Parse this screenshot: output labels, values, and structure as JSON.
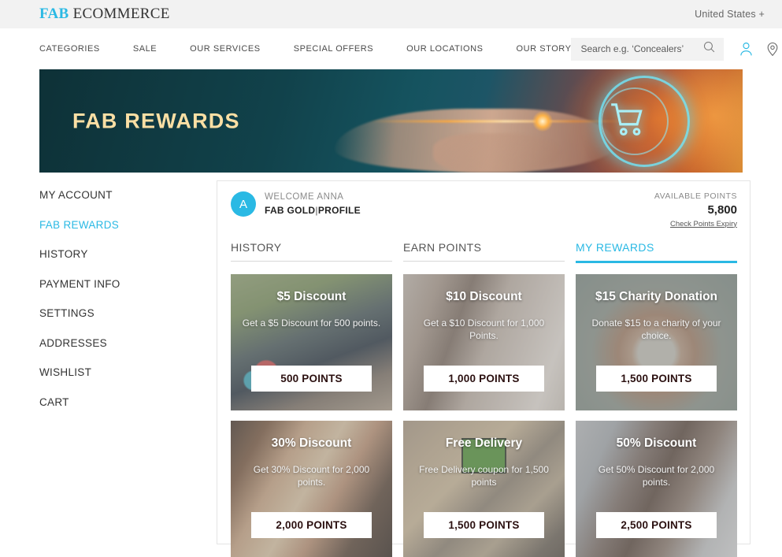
{
  "topbar": {
    "brand_primary": "FAB",
    "brand_secondary": "ECOMMERCE",
    "country": "United States +"
  },
  "nav": {
    "links": [
      {
        "label": "CATEGORIES"
      },
      {
        "label": "SALE"
      },
      {
        "label": "OUR SERVICES"
      },
      {
        "label": "SPECIAL OFFERS"
      },
      {
        "label": "OUR LOCATIONS"
      },
      {
        "label": "OUR STORY"
      }
    ],
    "search": {
      "placeholder": "Search e.g. ‘Concealers’",
      "value": ""
    },
    "icons": [
      "user-icon",
      "location-pin-icon",
      "bag-icon"
    ]
  },
  "hero": {
    "title": "FAB REWARDS"
  },
  "sidebar": {
    "items": [
      {
        "label": "MY ACCOUNT",
        "active": false
      },
      {
        "label": "FAB REWARDS",
        "active": true
      },
      {
        "label": "HISTORY",
        "active": false
      },
      {
        "label": "PAYMENT INFO",
        "active": false
      },
      {
        "label": "SETTINGS",
        "active": false
      },
      {
        "label": "ADDRESSES",
        "active": false
      },
      {
        "label": "WISHLIST",
        "active": false
      },
      {
        "label": "CART",
        "active": false
      }
    ]
  },
  "account": {
    "avatar_initial": "A",
    "welcome": "WELCOME ANNA",
    "tier": "FAB GOLD",
    "tier_separator": "|",
    "profile_link": "PROFILE",
    "points_label": "AVAILABLE POINTS",
    "points_value": "5,800",
    "points_expiry_link": "Check Points Expiry"
  },
  "tabs": [
    {
      "label": "HISTORY",
      "active": false
    },
    {
      "label": "EARN POINTS",
      "active": false
    },
    {
      "label": "MY REWARDS",
      "active": true
    }
  ],
  "rewards": [
    {
      "title": "$5 Discount",
      "description": "Get a $5 Discount for 500 points.",
      "points_button": "500 POINTS",
      "image": "shopping-cart-photo"
    },
    {
      "title": "$10 Discount",
      "description": "Get a $10 Discount for 1,000 Points.",
      "points_button": "1,000 POINTS",
      "image": "woman-in-store-photo"
    },
    {
      "title": "$15 Charity Donation",
      "description": "Donate $15 to a charity of your choice.",
      "points_button": "1,500 POINTS",
      "image": "hands-holding-jar-photo"
    },
    {
      "title": "30% Discount",
      "description": "Get 30% Discount for 2,000 points.",
      "points_button": "2,000 POINTS",
      "image": "friends-selfie-photo"
    },
    {
      "title": "Free Delivery",
      "description": "Free Delivery coupon for 1,500 points",
      "points_button": "1,500 POINTS",
      "image": "parcel-delivery-photo"
    },
    {
      "title": "50% Discount",
      "description": "Get 50% Discount for 2,000 points.",
      "points_button": "2,500 POINTS",
      "image": "woman-with-card-photo"
    }
  ],
  "colors": {
    "accent": "#2ab9e4",
    "hero_text": "#fbdfa4",
    "hero_dark": "#0e3137",
    "topbar_bg": "#f2f2f2"
  }
}
